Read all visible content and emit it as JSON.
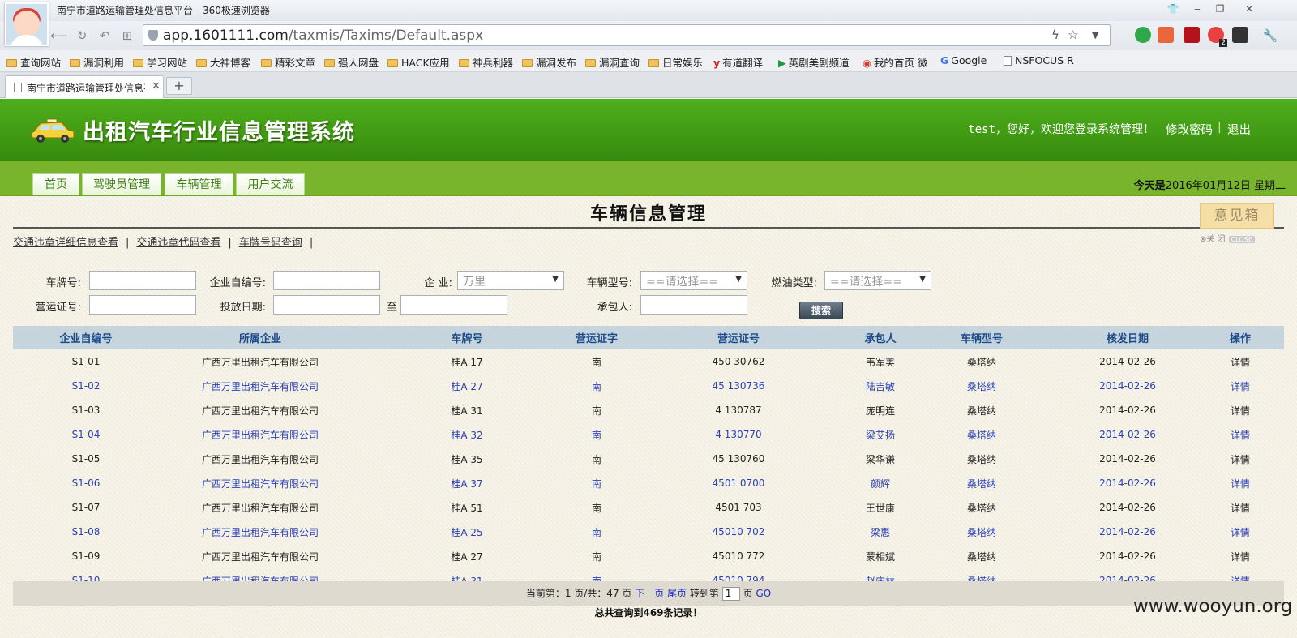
{
  "browser": {
    "window_title": "南宁市道路运输管理处信息平台 - 360极速浏览器",
    "url_host": "app.1601111.com",
    "url_path": "/taxmis/Taxims/Default.aspx",
    "tab_title": "南宁市道路运输管理处信息平台",
    "bookmarks": [
      "查询网站",
      "漏洞利用",
      "学习网站",
      "大神博客",
      "精彩文章",
      "强人网盘",
      "HACK应用",
      "神兵利器",
      "漏洞发布",
      "漏洞查询",
      "日常娱乐",
      "有道翻译",
      "英剧美剧频道",
      "我的首页 微",
      "Google",
      "NSFOCUS R"
    ],
    "extension_badge": "2"
  },
  "header": {
    "system_title": "出租汽车行业信息管理系统",
    "greeting": "test，您好，欢迎您登录系统管理！",
    "change_password": "修改密码",
    "logout": "退出",
    "separator": "|"
  },
  "nav": {
    "tabs": [
      "首页",
      "驾驶员管理",
      "车辆管理",
      "用户交流"
    ],
    "today_label": "今天是",
    "today_value": "2016年01月12日 星期二"
  },
  "page": {
    "title": "车辆信息管理",
    "feedback": "意见箱",
    "feedback_close": "⊗关 闭",
    "feedback_close_chip": "CLOSE",
    "quick_links": [
      "交通违章详细信息查看",
      "交通违章代码查看",
      "车牌号码查询"
    ],
    "quick_sep": "|"
  },
  "search": {
    "plate_label": "车牌号:",
    "company_no_label": "企业自编号:",
    "company_label": "企  业:",
    "company_value": "万里",
    "vehicle_type_label": "车辆型号:",
    "vehicle_type_value": "==请选择==",
    "fuel_label": "燃油类型:",
    "fuel_value": "==请选择==",
    "license_label": "营运证号:",
    "date_label": "投放日期:",
    "date_to": "至",
    "contractor_label": "承包人:",
    "search_button": "搜索"
  },
  "table": {
    "headers": [
      "企业自编号",
      "所属企业",
      "车牌号",
      "营运证字",
      "营运证号",
      "承包人",
      "车辆型号",
      "核发日期",
      "操作"
    ],
    "rows": [
      [
        "S1-01",
        "广西万里出租汽车有限公司",
        "桂A   17",
        "南",
        "450     30762",
        "韦军美",
        "桑塔纳",
        "2014-02-26",
        "详情"
      ],
      [
        "S1-02",
        "广西万里出租汽车有限公司",
        "桂A   27",
        "南",
        "45     130736",
        "陆吉敏",
        "桑塔纳",
        "2014-02-26",
        "详情"
      ],
      [
        "S1-03",
        "广西万里出租汽车有限公司",
        "桂A   31",
        "南",
        "4      130787",
        "庞明连",
        "桑塔纳",
        "2014-02-26",
        "详情"
      ],
      [
        "S1-04",
        "广西万里出租汽车有限公司",
        "桂A   32",
        "南",
        "4      130770",
        "梁艾扬",
        "桑塔纳",
        "2014-02-26",
        "详情"
      ],
      [
        "S1-05",
        "广西万里出租汽车有限公司",
        "桂A   35",
        "南",
        "45     130760",
        "梁华谦",
        "桑塔纳",
        "2014-02-26",
        "详情"
      ],
      [
        "S1-06",
        "广西万里出租汽车有限公司",
        "桂A   37",
        "南",
        "4501    0700",
        "颜辉",
        "桑塔纳",
        "2014-02-26",
        "详情"
      ],
      [
        "S1-07",
        "广西万里出租汽车有限公司",
        "桂A   51",
        "南",
        "4501     703",
        "王世康",
        "桑塔纳",
        "2014-02-26",
        "详情"
      ],
      [
        "S1-08",
        "广西万里出租汽车有限公司",
        "桂A   25",
        "南",
        "45010    702",
        "梁惠",
        "桑塔纳",
        "2014-02-26",
        "详情"
      ],
      [
        "S1-09",
        "广西万里出租汽车有限公司",
        "桂A   27",
        "南",
        "45010    772",
        "蒙相斌",
        "桑塔纳",
        "2014-02-26",
        "详情"
      ],
      [
        "S1-10",
        "广西万里出租汽车有限公司",
        "桂A   31",
        "南",
        "45010    794",
        "赵庆林",
        "桑塔纳",
        "2014-02-26",
        "详情"
      ]
    ]
  },
  "pager": {
    "current_label": "当前第：1 页/共：47 页",
    "next": "下一页",
    "last": "尾页",
    "goto_label": "转到第",
    "goto_value": "1",
    "page_unit": "页",
    "go": "GO",
    "total": "总共查询到469条记录！"
  },
  "watermark": "www.wooyun.org",
  "colors": {
    "header_green": "#3e9612",
    "nav_green": "#78b52c",
    "content_bg": "#f2efe0",
    "table_header_bg": "#c6d4dd",
    "link_blue": "#1a2cc8"
  }
}
